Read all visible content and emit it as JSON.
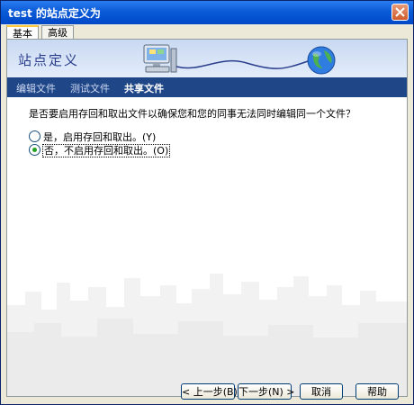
{
  "window": {
    "title": "test 的站点定义为"
  },
  "tabs": [
    {
      "label": "基本",
      "active": true
    },
    {
      "label": "高级",
      "active": false
    }
  ],
  "banner": {
    "title": "站点定义"
  },
  "nav": [
    {
      "label": "编辑文件",
      "active": false
    },
    {
      "label": "测试文件",
      "active": false
    },
    {
      "label": "共享文件",
      "active": true
    }
  ],
  "main": {
    "question": "是否要启用存回和取出文件以确保您和您的同事无法同时编辑同一个文件？",
    "options": [
      {
        "label": "是，启用存回和取出。(Y)",
        "checked": false
      },
      {
        "label": "否，不启用存回和取出。(O)",
        "checked": true
      }
    ]
  },
  "buttons": {
    "back": "< 上一步(B)",
    "next": "下一步(N) >",
    "cancel": "取消",
    "help": "帮助"
  },
  "colors": {
    "title_bar": "#0a5bd7",
    "nav_bar": "#1f4687",
    "dialog_bg": "#ece9d8"
  },
  "icons": {
    "close": "close-icon",
    "computer": "computer-icon",
    "globe": "globe-icon"
  }
}
